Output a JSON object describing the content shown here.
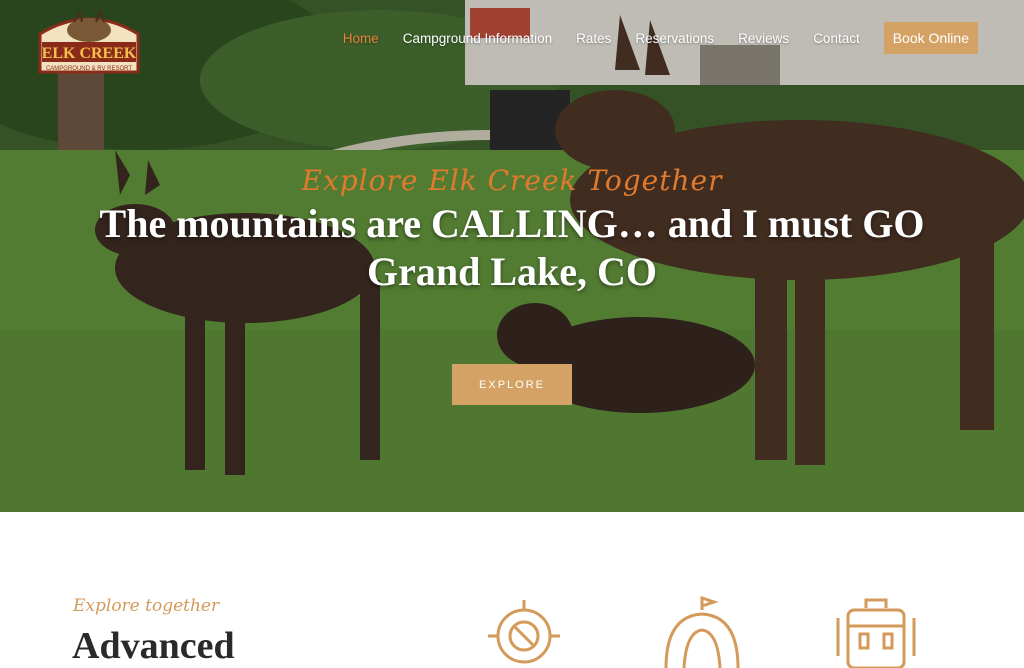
{
  "brand": {
    "logo_line1": "ELK CREEK",
    "logo_line2": "CAMPGROUND & RV RESORT"
  },
  "nav": {
    "items": [
      {
        "label": "Home",
        "active": true
      },
      {
        "label": "Campground Information",
        "active": false
      },
      {
        "label": "Rates",
        "active": false
      },
      {
        "label": "Reservations",
        "active": false
      },
      {
        "label": "Reviews",
        "active": false
      },
      {
        "label": "Contact",
        "active": false
      }
    ],
    "book_label": "Book Online"
  },
  "hero": {
    "eyebrow": "Explore Elk Creek Together",
    "headline_line1": "The mountains are CALLING… and I must GO",
    "headline_line2": "Grand Lake, CO",
    "cta_label": "EXPLORE"
  },
  "section": {
    "eyebrow": "Explore together",
    "heading": "Advanced"
  },
  "features": {
    "icons": [
      "compass-icon",
      "tent-icon",
      "backpack-icon"
    ]
  },
  "colors": {
    "accent": "#d5a265",
    "active_nav": "#e8843a",
    "eyebrow": "#e07a2e",
    "icon": "#d49a5a"
  }
}
